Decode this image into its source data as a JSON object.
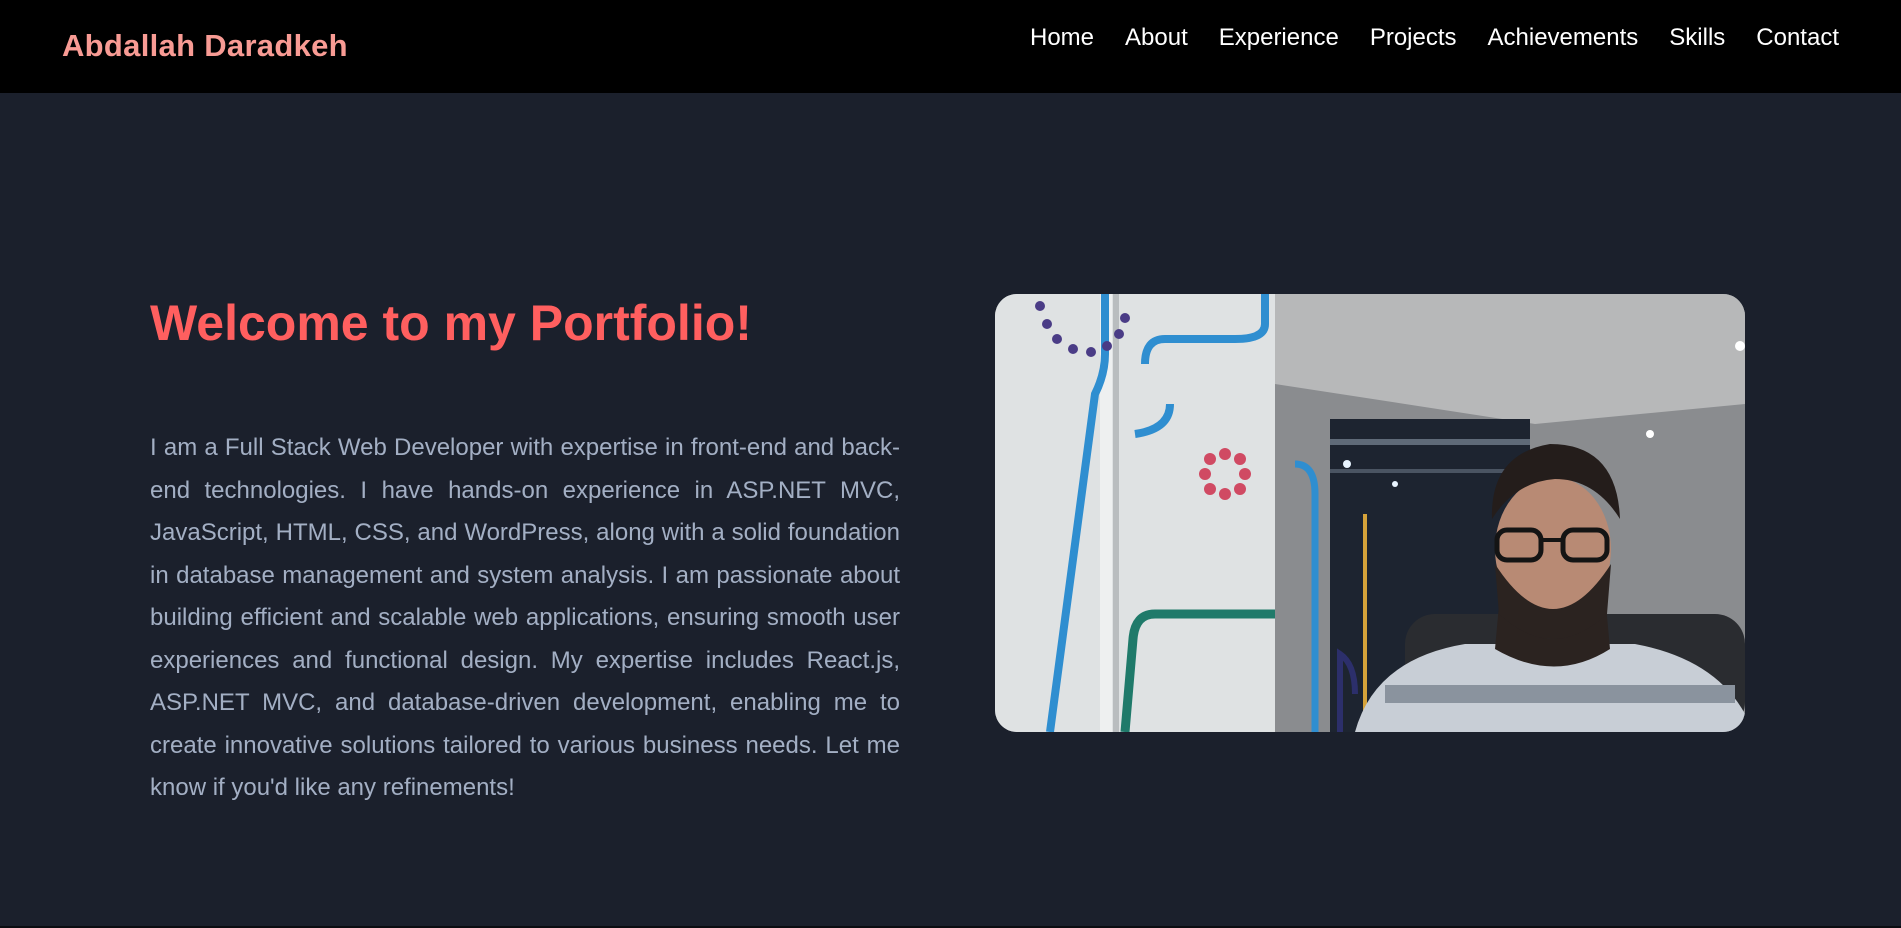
{
  "navbar": {
    "brand": "Abdallah Daradkeh",
    "links": [
      "Home",
      "About",
      "Experience",
      "Projects",
      "Achievements",
      "Skills",
      "Contact"
    ]
  },
  "hero": {
    "title": "Welcome to my Portfolio!",
    "description": "I am a Full Stack Web Developer with expertise in front-end and back-end technologies. I have hands-on experience in ASP.NET MVC, JavaScript, HTML, CSS, and WordPress, along with a solid foundation in database management and system analysis. I am passionate about building efficient and scalable web applications, ensuring smooth user experiences and functional design. My expertise includes React.js, ASP.NET MVC, and database-driven development, enabling me to create innovative solutions tailored to various business needs. Let me know if you'd like any refinements!",
    "photo_icon": "profile-photo"
  },
  "colors": {
    "navbar_bg": "#000000",
    "page_bg": "#1b202c",
    "brand": "#f89b94",
    "title": "#ff5f5f",
    "body_text": "#a3afc4",
    "nav_text": "#ffffff"
  }
}
